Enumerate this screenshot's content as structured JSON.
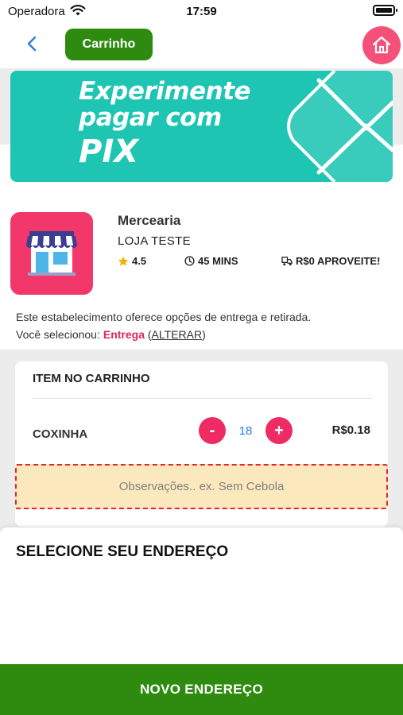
{
  "status_bar": {
    "carrier": "Operadora",
    "time": "17:59"
  },
  "nav": {
    "title": "Carrinho"
  },
  "banner": {
    "line1": "Experimente",
    "line2": "pagar com",
    "line3": "PIX"
  },
  "store": {
    "name": "Mercearia",
    "subtitle": "LOJA TESTE",
    "rating": "4.5",
    "time": "45 MINS",
    "delivery": "R$0 APROVEITE!"
  },
  "info": {
    "text": "Este estabelecimento oferece opções de entrega e retirada.",
    "selected_label": "Você selecionou:",
    "selected_mode": "Entrega",
    "paren_open": "(",
    "change_label": "ALTERAR",
    "paren_close": ")"
  },
  "cart": {
    "title": "ITEM NO CARRINHO",
    "item_name": "COXINHA",
    "quantity": "18",
    "price": "R$0.18",
    "minus": "-",
    "plus": "+",
    "notes_placeholder": "Observações.. ex. Sem Cebola"
  },
  "address": {
    "title": "SELECIONE SEU ENDEREÇO"
  },
  "footer": {
    "button_label": "NOVO ENDEREÇO"
  },
  "colors": {
    "primary_green": "#2e8b10",
    "accent_pink": "#ee2b63",
    "banner_teal": "#1ec5b3",
    "notes_bg": "#fbe8bd"
  }
}
